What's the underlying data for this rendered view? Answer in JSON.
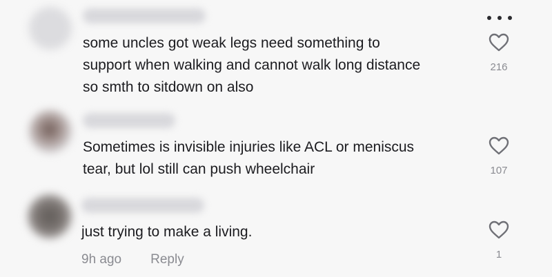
{
  "comments": [
    {
      "text_lines": [
        "some uncles got weak legs need something to",
        "support when walking and cannot walk long distance",
        "so smth to sitdown on also"
      ],
      "like_count": "216"
    },
    {
      "text_lines": [
        "Sometimes is invisible injuries like ACL or meniscus",
        "tear, but lol still can push wheelchair"
      ],
      "like_count": "107"
    },
    {
      "text_lines": [
        "just trying to make a living."
      ],
      "like_count": "1",
      "time": "9h ago",
      "reply_label": "Reply"
    }
  ],
  "icons": {
    "like": "heart-outline-icon",
    "more": "more-options-icon"
  },
  "colors": {
    "background": "#f7f7f7",
    "text": "#1b1b1f",
    "muted": "#8a8b91"
  }
}
